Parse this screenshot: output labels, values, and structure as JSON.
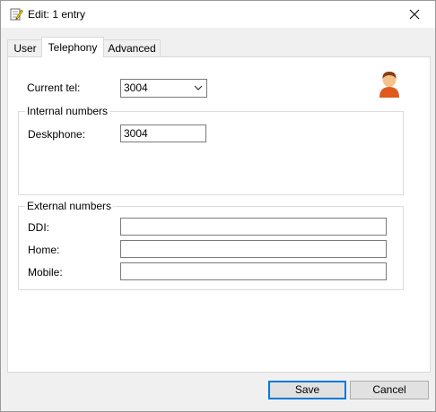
{
  "window": {
    "title": "Edit: 1 entry"
  },
  "tabs": [
    {
      "label": "User"
    },
    {
      "label": "Telephony"
    },
    {
      "label": "Advanced"
    }
  ],
  "telephony": {
    "current_tel_label": "Current tel:",
    "current_tel_value": "3004",
    "internal": {
      "title": "Internal numbers",
      "deskphone_label": "Deskphone:",
      "deskphone_value": "3004"
    },
    "external": {
      "title": "External numbers",
      "ddi_label": "DDI:",
      "ddi_value": "",
      "home_label": "Home:",
      "home_value": "",
      "mobile_label": "Mobile:",
      "mobile_value": ""
    }
  },
  "footer": {
    "save_label": "Save",
    "cancel_label": "Cancel"
  },
  "icons": {
    "title": "edit-notepad-icon",
    "close": "close-icon",
    "dropdown": "chevron-down-icon",
    "avatar": "user-avatar-icon"
  },
  "colors": {
    "accent": "#0078d7",
    "avatar_hair": "#8b3a12",
    "avatar_body": "#e05a1e"
  }
}
